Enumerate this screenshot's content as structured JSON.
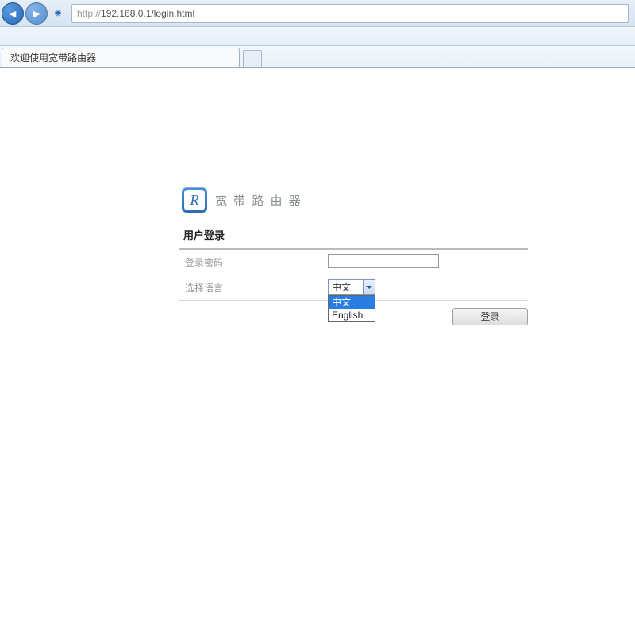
{
  "browser": {
    "url_proto": "http://",
    "url_rest": "192.168.0.1/login.html",
    "tab_title": "欢迎使用宽带路由器"
  },
  "brand": {
    "logo_letter": "R",
    "title": "宽 带 路 由 器"
  },
  "form": {
    "panel_title": "用户登录",
    "password_label": "登录密码",
    "password_value": "",
    "lang_label": "选择语言",
    "lang_selected": "中文",
    "lang_options": [
      "中文",
      "English"
    ],
    "submit_label": "登录"
  }
}
